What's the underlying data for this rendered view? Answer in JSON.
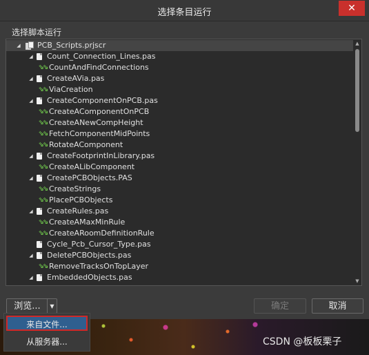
{
  "window": {
    "title": "选择条目运行",
    "close_icon": "close-icon"
  },
  "section_label": "选择脚本运行",
  "tree": [
    {
      "level": 0,
      "icon": "project-icon",
      "expandable": true,
      "label": "PCB_Scripts.prjscr",
      "selected": true
    },
    {
      "level": 1,
      "icon": "file-icon",
      "expandable": true,
      "label": "Count_Connection_Lines.pas"
    },
    {
      "level": 2,
      "icon": "procedure-icon",
      "expandable": false,
      "label": "CountAndFindConnections"
    },
    {
      "level": 1,
      "icon": "file-icon",
      "expandable": true,
      "label": "CreateAVia.pas"
    },
    {
      "level": 2,
      "icon": "procedure-icon",
      "expandable": false,
      "label": "ViaCreation"
    },
    {
      "level": 1,
      "icon": "file-icon",
      "expandable": true,
      "label": "CreateComponentOnPCB.pas"
    },
    {
      "level": 2,
      "icon": "procedure-icon",
      "expandable": false,
      "label": "CreateAComponentOnPCB"
    },
    {
      "level": 2,
      "icon": "procedure-icon",
      "expandable": false,
      "label": "CreateANewCompHeight"
    },
    {
      "level": 2,
      "icon": "procedure-icon",
      "expandable": false,
      "label": "FetchComponentMidPoints"
    },
    {
      "level": 2,
      "icon": "procedure-icon",
      "expandable": false,
      "label": "RotateAComponent"
    },
    {
      "level": 1,
      "icon": "file-icon",
      "expandable": true,
      "label": "CreateFootprintInLibrary.pas"
    },
    {
      "level": 2,
      "icon": "procedure-icon",
      "expandable": false,
      "label": "CreateALibComponent"
    },
    {
      "level": 1,
      "icon": "file-icon",
      "expandable": true,
      "label": "CreatePCBObjects.PAS"
    },
    {
      "level": 2,
      "icon": "procedure-icon",
      "expandable": false,
      "label": "CreateStrings"
    },
    {
      "level": 2,
      "icon": "procedure-icon",
      "expandable": false,
      "label": "PlacePCBObjects"
    },
    {
      "level": 1,
      "icon": "file-icon",
      "expandable": true,
      "label": "CreateRules.pas"
    },
    {
      "level": 2,
      "icon": "procedure-icon",
      "expandable": false,
      "label": "CreateAMaxMinRule"
    },
    {
      "level": 2,
      "icon": "procedure-icon",
      "expandable": false,
      "label": "CreateARoomDefinitionRule"
    },
    {
      "level": 1,
      "icon": "file-icon",
      "expandable": false,
      "label": "Cycle_Pcb_Cursor_Type.pas"
    },
    {
      "level": 1,
      "icon": "file-icon",
      "expandable": true,
      "label": "DeletePCBObjects.pas"
    },
    {
      "level": 2,
      "icon": "procedure-icon",
      "expandable": false,
      "label": "RemoveTracksOnTopLayer"
    },
    {
      "level": 1,
      "icon": "file-icon",
      "expandable": true,
      "label": "EmbeddedObjects.pas"
    }
  ],
  "buttons": {
    "browse": "浏览...",
    "ok": "确定",
    "cancel": "取消"
  },
  "browse_menu": {
    "items": [
      "来自文件...",
      "从服务器..."
    ]
  },
  "watermark": "CSDN @板板栗子"
}
